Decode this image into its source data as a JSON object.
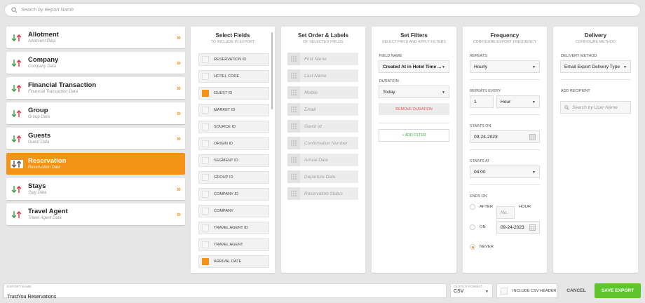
{
  "search": {
    "placeholder": "Search by Report Name"
  },
  "categories": [
    {
      "title": "Allotment",
      "subtitle": "Allotment Data"
    },
    {
      "title": "Company",
      "subtitle": "Company Data"
    },
    {
      "title": "Financial Transaction",
      "subtitle": "Financial Transaction Data"
    },
    {
      "title": "Group",
      "subtitle": "Group Data"
    },
    {
      "title": "Guests",
      "subtitle": "Guest Data"
    },
    {
      "title": "Reservation",
      "subtitle": "Reservation Data"
    },
    {
      "title": "Stays",
      "subtitle": "Stay Data"
    },
    {
      "title": "Travel Agent",
      "subtitle": "Travel Agent Data"
    }
  ],
  "chevron": "»",
  "select_fields": {
    "title": "Select Fields",
    "subtitle": "To include in export",
    "fields": [
      {
        "label": "RESERVATION ID",
        "checked": false
      },
      {
        "label": "HOTEL CODE",
        "checked": false
      },
      {
        "label": "GUEST ID",
        "checked": true
      },
      {
        "label": "MARKET ID",
        "checked": false
      },
      {
        "label": "SOURCE ID",
        "checked": false
      },
      {
        "label": "ORIGIN ID",
        "checked": false
      },
      {
        "label": "SEGMENT ID",
        "checked": false
      },
      {
        "label": "GROUP ID",
        "checked": false
      },
      {
        "label": "COMPANY ID",
        "checked": false
      },
      {
        "label": "COMPANY",
        "checked": false
      },
      {
        "label": "TRAVEL AGENT ID",
        "checked": false
      },
      {
        "label": "TRAVEL AGENT",
        "checked": false
      },
      {
        "label": "ARRIVAL DATE",
        "checked": true
      }
    ]
  },
  "order": {
    "title": "Set Order & Labels",
    "subtitle": "of selected fields",
    "items": [
      "First Name",
      "Last Name",
      "Mobile",
      "Email",
      "Guest Id",
      "Confirmation Number",
      "Arrival Date",
      "Departure Date",
      "Reservation Status"
    ]
  },
  "filters": {
    "title": "Set Filters",
    "subtitle": "Select field and apply filters",
    "field_name_label": "FIELD NAME",
    "field_name_value": "Created At in Hotel Time ...",
    "duration_label": "DURATION",
    "duration_value": "Today",
    "remove_label": "REMOVE DURATION",
    "add_label": "+ ADD FILTER"
  },
  "frequency": {
    "title": "Frequency",
    "subtitle": "Configure export frequency",
    "repeats_label": "REPEATS",
    "repeats_value": "Hourly",
    "repeats_every_label": "REPEATS EVERY",
    "repeats_every_value": "1",
    "repeats_every_unit": "Hour",
    "starts_on_label": "STARTS ON",
    "starts_on_value": "09-24-2023",
    "starts_at_label": "STARTS AT",
    "starts_at_value": "04:00",
    "ends_on_label": "ENDS ON",
    "after_label": "AFTER",
    "after_placeholder": "No.",
    "hour_label": "HOUR",
    "on_label": "ON",
    "on_value": "09-24-2023",
    "never_label": "NEVER"
  },
  "delivery": {
    "title": "Delivery",
    "subtitle": "Configure method",
    "method_label": "DELIVERY METHOD",
    "method_value": "Email Export Delivery Type",
    "recipient_label": "ADD RECIPIENT",
    "recipient_placeholder": "Search by User Name"
  },
  "bottom": {
    "export_name_label": "EXPORT NAME",
    "export_name_value": "TrustYou Reservations",
    "format_label": "OUTPUT FORMAT",
    "format_value": "CSV",
    "csv_header_label": "INCLUDE CSV HEADER",
    "cancel_label": "CANCEL",
    "save_label": "SAVE EXPORT"
  },
  "colors": {
    "accent": "#f39317",
    "save": "#5fc52e",
    "remove": "#e05050",
    "add": "#3cb043"
  }
}
